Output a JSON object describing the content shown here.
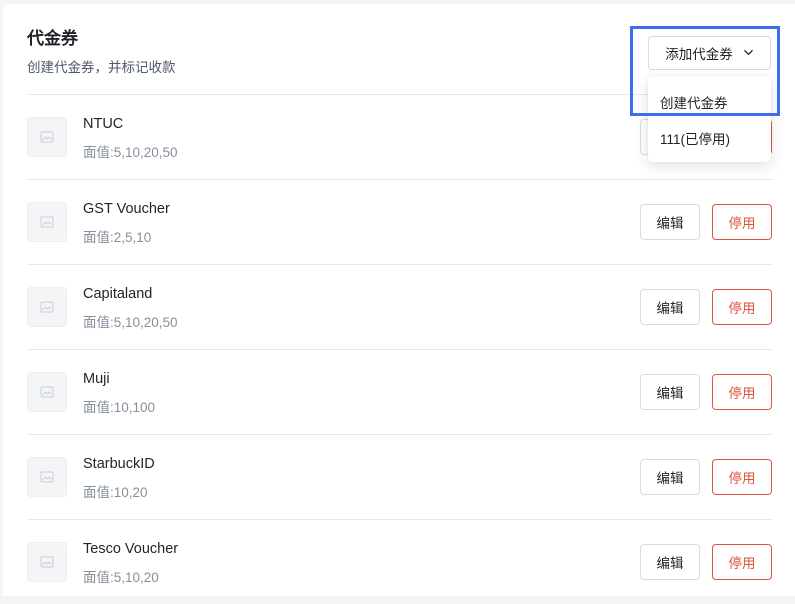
{
  "header": {
    "title": "代金券",
    "subtitle": "创建代金券，并标记收款"
  },
  "add_button": {
    "label": "添加代金券",
    "icon": "chevron-down-icon"
  },
  "dropdown": {
    "items": [
      {
        "label": "创建代金券"
      },
      {
        "label": "111(已停用)"
      }
    ]
  },
  "vouchers": [
    {
      "name": "NTUC",
      "denominations": "面值:5,10,20,50"
    },
    {
      "name": "GST Voucher",
      "denominations": "面值:2,5,10"
    },
    {
      "name": "Capitaland",
      "denominations": "面值:5,10,20,50"
    },
    {
      "name": "Muji",
      "denominations": "面值:10,100"
    },
    {
      "name": "StarbuckID",
      "denominations": "面值:10,20"
    },
    {
      "name": "Tesco Voucher",
      "denominations": "面值:5,10,20"
    }
  ],
  "actions": {
    "edit_label": "编辑",
    "disable_label": "停用"
  },
  "colors": {
    "accent_danger": "#e0553a",
    "highlight": "#3b6ee8",
    "border": "#d9dbe0",
    "muted_text": "#86909c"
  }
}
